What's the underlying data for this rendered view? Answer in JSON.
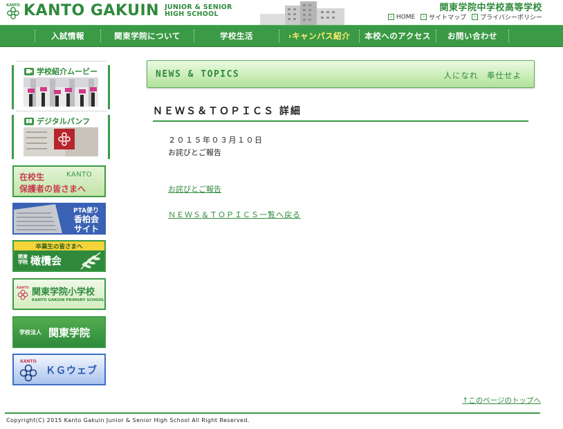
{
  "header": {
    "logo_text": "KANTO GAKUIN",
    "logo_sub_line1": "JUNIOR & SENIOR",
    "logo_sub_line2": "HIGH SCHOOL",
    "school_name": "関東学院中学校高等学校",
    "links": [
      {
        "label": "HOME"
      },
      {
        "label": "サイトマップ"
      },
      {
        "label": "プライバシーポリシー"
      }
    ]
  },
  "nav": {
    "items": [
      {
        "label": "入試情報"
      },
      {
        "label": "関東学院について"
      },
      {
        "label": "学校生活"
      },
      {
        "label": "›キャンパス紹介"
      },
      {
        "label": "本校へのアクセス"
      },
      {
        "label": "お問い合わせ"
      }
    ]
  },
  "sidebar": {
    "movie_title": "学校紹介ムービー",
    "pamphlet_title": "デジタルパンフ",
    "banners": {
      "students": {
        "line1": "在校生",
        "line2": "保護者の皆さまへ",
        "brand": "KANTO"
      },
      "pta": {
        "line1": "PTA便り",
        "line2": "香柏会",
        "line3": "サイト"
      },
      "alumni": {
        "line1": "卒業生の皆さまへ",
        "small": "関東学院",
        "big": "橄欖会"
      },
      "primary": {
        "title": "関東学院小学校",
        "sub": "KANTO GAKUIN PRIMARY SCHOOL"
      },
      "corporate": {
        "small": "学校法人",
        "big": "関東学院"
      },
      "kgweb": {
        "brand": "KANTO",
        "label": "ＫＧウェブ"
      }
    }
  },
  "main": {
    "section_title": "NEWS & TOPICS",
    "motto": "人になれ　奉仕せよ",
    "detail_title": "ＮＥＷＳ＆ＴＯＰＩＣＳ 詳細",
    "date": "２０１５年０３月１０日",
    "subject": "お詫びとご報告",
    "attachment_link": "お詫びとご報告",
    "back_link": "ＮＥＷＳ＆ＴＯＰＩＣＳ一覧へ戻る"
  },
  "footer": {
    "page_top": "↑このページのトップへ",
    "copyright": "Copyright(C) 2015 Kanto Gakuin Junior & Senior High School All Right Reserved."
  },
  "colors": {
    "brand_green": "#3b9a45",
    "nav_active": "#ffee70",
    "link_green": "#2f8a3c"
  }
}
